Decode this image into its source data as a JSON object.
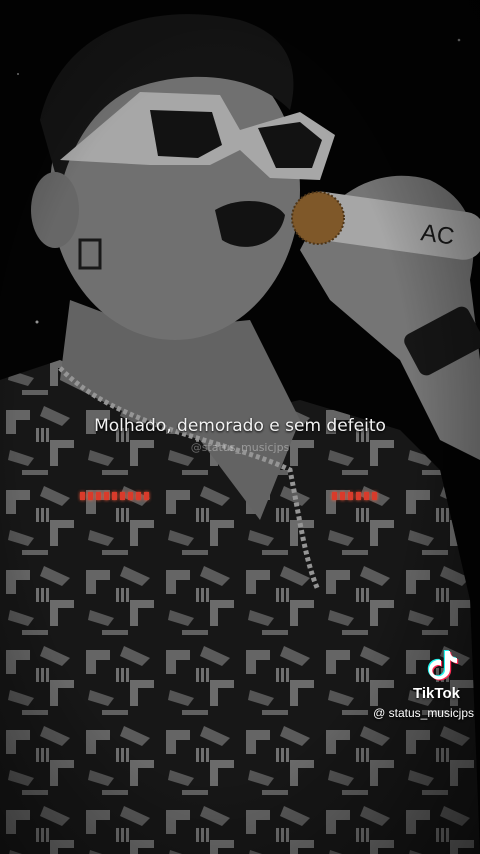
{
  "lyrics": {
    "line": "Molhado, demorado e sem defeito",
    "watermark": "@status_musicjps"
  },
  "tiktok": {
    "brand": "TikTok",
    "handle": "@ status_musicjps",
    "logo_icon": "tiktok-note-icon"
  },
  "visualizer": {
    "left_bars": 9,
    "right_bars": 6,
    "color": "#d93b2b"
  },
  "colors": {
    "background": "#050505",
    "text": "#f2f2f2"
  }
}
